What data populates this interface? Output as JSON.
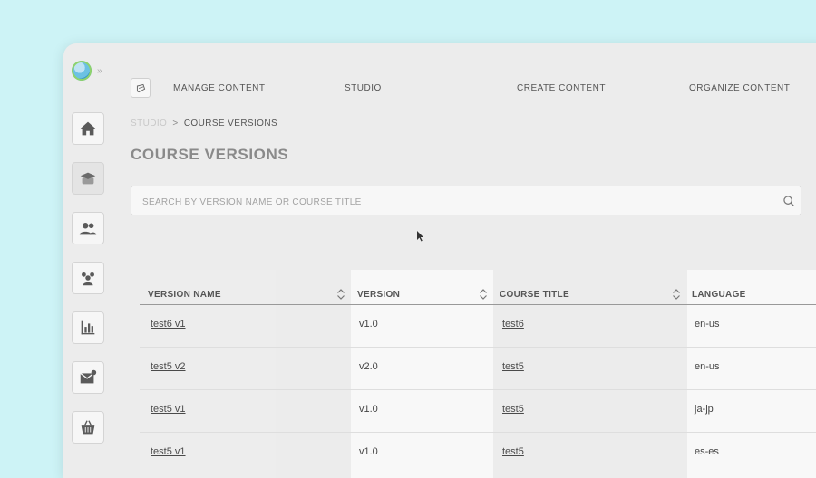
{
  "nav": {
    "items": [
      {
        "label": "MANAGE CONTENT"
      },
      {
        "label": "STUDIO"
      },
      {
        "label": "CREATE CONTENT"
      },
      {
        "label": "ORGANIZE CONTENT"
      }
    ]
  },
  "sidebar": {
    "icons": [
      "home-icon",
      "courses-icon",
      "users-icon",
      "groups-icon",
      "reports-icon",
      "messages-icon",
      "store-icon"
    ]
  },
  "breadcrumb": {
    "root": "STUDIO",
    "separator": ">",
    "current": "COURSE VERSIONS"
  },
  "page": {
    "title": "COURSE VERSIONS"
  },
  "search": {
    "placeholder": "SEARCH BY VERSION NAME OR COURSE TITLE"
  },
  "table": {
    "columns": [
      {
        "label": "VERSION NAME"
      },
      {
        "label": "VERSION"
      },
      {
        "label": "COURSE TITLE"
      },
      {
        "label": "LANGUAGE"
      }
    ],
    "rows": [
      {
        "version_name": "test6 v1",
        "version": "v1.0",
        "course_title": "test6",
        "language": "en-us"
      },
      {
        "version_name": "test5 v2",
        "version": "v2.0",
        "course_title": "test5",
        "language": "en-us"
      },
      {
        "version_name": "test5 v1",
        "version": "v1.0",
        "course_title": "test5",
        "language": "ja-jp"
      },
      {
        "version_name": "test5 v1",
        "version": "v1.0",
        "course_title": "test5",
        "language": "es-es"
      }
    ]
  },
  "colors": {
    "background": "#cdf3f6",
    "window": "#ececec",
    "text": "#4a4a4a",
    "title": "#8a8a8a"
  }
}
